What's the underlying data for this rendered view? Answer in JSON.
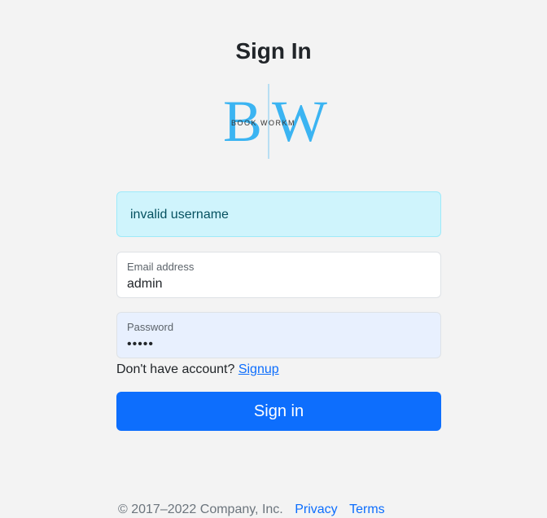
{
  "page": {
    "title": "Sign In"
  },
  "logo": {
    "letters_left": "B",
    "letters_right": "W",
    "wordmark": "BOOK WORKM",
    "color": "#3bb4f2"
  },
  "alert": {
    "message": "invalid username"
  },
  "email": {
    "label": "Email address",
    "value": "admin"
  },
  "password": {
    "label": "Password",
    "value": "•••••"
  },
  "signup": {
    "prompt": "Don't have account?",
    "link": "Signup"
  },
  "submit": {
    "label": "Sign in"
  },
  "footer": {
    "copyright": "© 2017–2022 Company, Inc.",
    "privacy": "Privacy",
    "terms": "Terms"
  }
}
